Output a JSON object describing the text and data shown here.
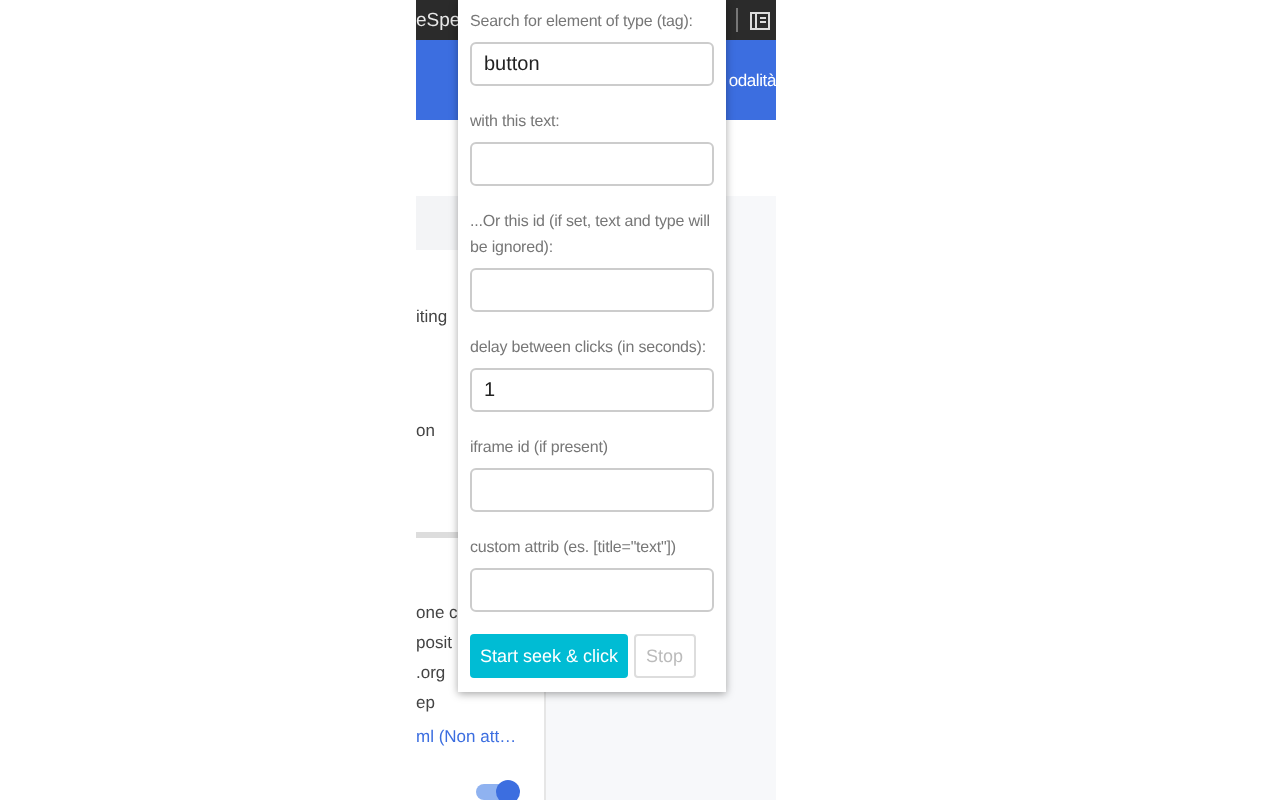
{
  "background_page": {
    "toolbar_text": "eSpe",
    "banner_text": "odalità",
    "upper_items": [
      {
        "text": "iting",
        "kind": "text"
      },
      {
        "text": "on",
        "kind": "text"
      }
    ],
    "lower_items": [
      {
        "text": "one c",
        "kind": "text"
      },
      {
        "text": "posit",
        "kind": "text"
      },
      {
        "text": ".org",
        "kind": "text"
      },
      {
        "text": "ep",
        "kind": "text"
      },
      {
        "text": "ml (Non att…",
        "kind": "link"
      }
    ],
    "toggle": {
      "on": true
    }
  },
  "popup": {
    "fields": [
      {
        "label": "Search for element of type (tag):",
        "value": "button"
      },
      {
        "label": "with this text:"
      },
      {
        "label": "...Or this id (if set, text and type will be ignored):"
      },
      {
        "label": "delay between clicks (in seconds):",
        "value": "1"
      },
      {
        "label": "iframe id (if present)"
      },
      {
        "label": "custom attrib (es. [title=\"text\"])"
      }
    ],
    "buttons": [
      {
        "label": "Start seek & click",
        "disabled": false
      },
      {
        "label": "Stop",
        "disabled": true
      }
    ]
  }
}
